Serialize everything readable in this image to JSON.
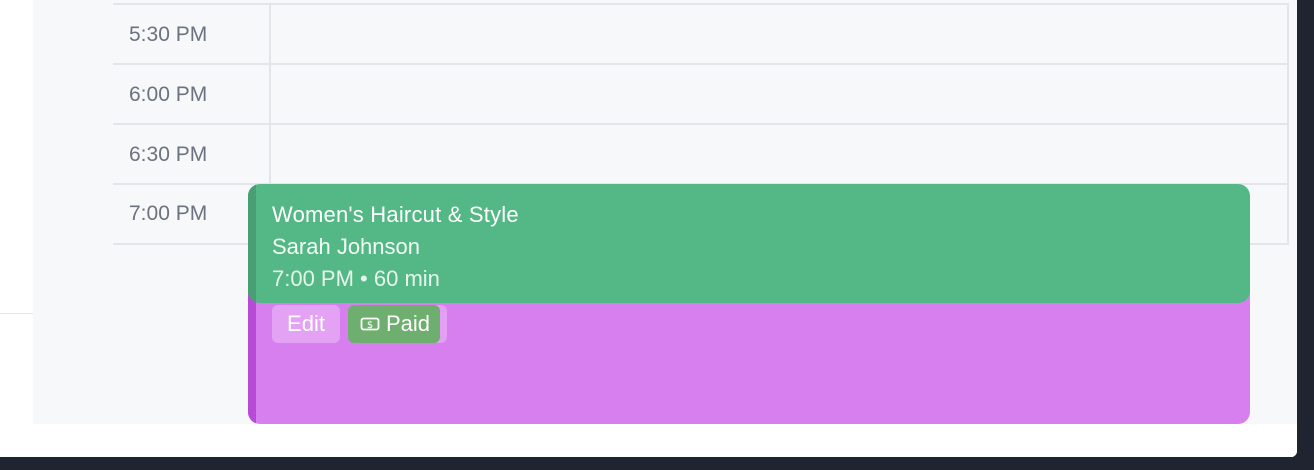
{
  "time_slots": [
    {
      "label": "5:30 PM"
    },
    {
      "label": "6:00 PM"
    },
    {
      "label": "6:30 PM"
    },
    {
      "label": "7:00 PM"
    }
  ],
  "appointment": {
    "title": "Women's Haircut & Style",
    "client": "Sarah Johnson",
    "time_duration": "7:00 PM • 60 min",
    "status_color": "#54b886"
  },
  "overlay_event": {
    "color": "#d87ff0",
    "edit_label": "Edit",
    "paid_label": "Paid",
    "paid_icon": "dollar-bill-icon"
  }
}
